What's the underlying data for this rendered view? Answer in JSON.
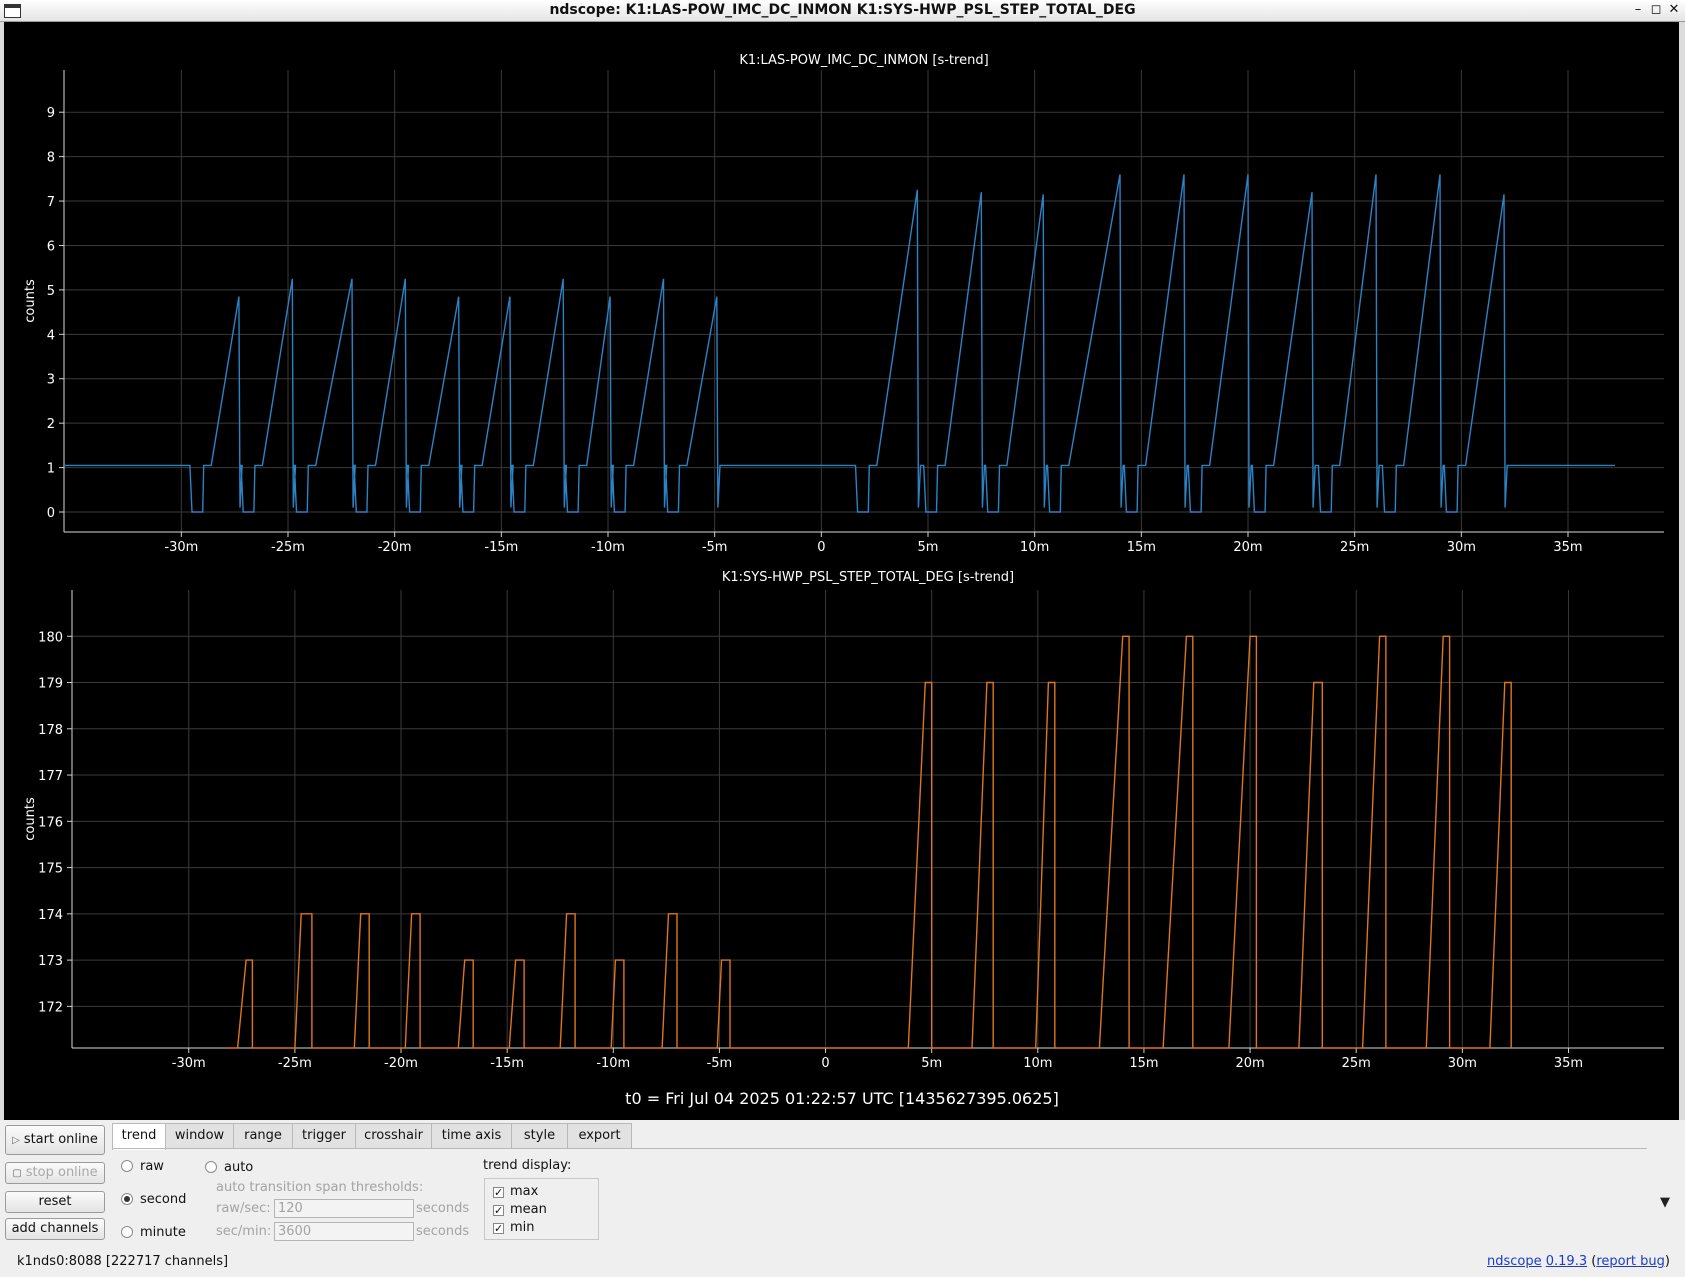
{
  "window": {
    "title": "ndscope: K1:LAS-POW_IMC_DC_INMON K1:SYS-HWP_PSL_STEP_TOTAL_DEG",
    "minimize_glyph": "–",
    "maximize_glyph": "◻",
    "close_glyph": "✕"
  },
  "plots": [
    {
      "title": "K1:LAS-POW_IMC_DC_INMON [s-trend]",
      "ylabel": "counts",
      "yticks": [
        "0",
        "1",
        "2",
        "3",
        "4",
        "5",
        "6",
        "7",
        "8",
        "9"
      ],
      "xticks": [
        "-30m",
        "-25m",
        "-20m",
        "-15m",
        "-10m",
        "-5m",
        "0",
        "5m",
        "10m",
        "15m",
        "20m",
        "25m",
        "30m",
        "35m"
      ]
    },
    {
      "title": "K1:SYS-HWP_PSL_STEP_TOTAL_DEG [s-trend]",
      "ylabel": "counts",
      "yticks": [
        "172",
        "173",
        "174",
        "175",
        "176",
        "177",
        "178",
        "179",
        "180"
      ],
      "xticks": [
        "-30m",
        "-25m",
        "-20m",
        "-15m",
        "-10m",
        "-5m",
        "0",
        "5m",
        "10m",
        "15m",
        "20m",
        "25m",
        "30m",
        "35m"
      ]
    }
  ],
  "t0_label": "t0 = Fri Jul 04 2025 01:22:57 UTC [1435627395.0625]",
  "buttons": {
    "start_online": "start online",
    "stop_online": "stop online",
    "reset": "reset",
    "add_channels": "add channels"
  },
  "tabs": [
    "trend",
    "window",
    "range",
    "trigger",
    "crosshair",
    "time axis",
    "style",
    "export"
  ],
  "trend_tab": {
    "radio_raw": "raw",
    "radio_second": "second",
    "radio_minute": "minute",
    "radio_auto": "auto",
    "thresholds_label": "auto transition span thresholds:",
    "raw_sec_label": "raw/sec:",
    "raw_sec_value": "120",
    "sec_min_label": "sec/min:",
    "sec_min_value": "3600",
    "unit": "seconds",
    "trend_display_label": "trend display:",
    "check_max": "max",
    "check_mean": "mean",
    "check_min": "min",
    "check_glyph": "✓"
  },
  "status": {
    "server": "k1nds0:8088  [222717 channels]",
    "app_link": "ndscope",
    "version_link": "0.19.3",
    "report_link": "report bug",
    "paren_open": "(",
    "paren_close": ")"
  },
  "chart_data": [
    {
      "type": "line",
      "title": "K1:LAS-POW_IMC_DC_INMON [s-trend]",
      "xlabel": "",
      "ylabel": "counts",
      "x_unit": "minutes relative to t0",
      "xlim": [
        -35.5,
        39.5
      ],
      "ylim": [
        -0.45,
        9.95
      ],
      "grid": true,
      "color": "#2b83c6",
      "baseline": 1.05,
      "sawtooth_cycles": [
        {
          "start": -29.5,
          "peak_time": -27.3,
          "peak": 4.85
        },
        {
          "start": -27.1,
          "peak_time": -24.8,
          "peak": 5.25
        },
        {
          "start": -24.6,
          "peak_time": -22.0,
          "peak": 5.25
        },
        {
          "start": -21.8,
          "peak_time": -19.5,
          "peak": 5.25
        },
        {
          "start": -19.3,
          "peak_time": -17.0,
          "peak": 4.85
        },
        {
          "start": -16.8,
          "peak_time": -14.6,
          "peak": 4.85
        },
        {
          "start": -14.4,
          "peak_time": -12.1,
          "peak": 5.25
        },
        {
          "start": -11.9,
          "peak_time": -9.9,
          "peak": 4.85
        },
        {
          "start": -9.7,
          "peak_time": -7.4,
          "peak": 5.25
        },
        {
          "start": -7.2,
          "peak_time": -4.9,
          "peak": 4.85
        },
        {
          "start": 1.7,
          "peak_time": 4.5,
          "peak": 7.25
        },
        {
          "start": 4.9,
          "peak_time": 7.5,
          "peak": 7.2
        },
        {
          "start": 7.8,
          "peak_time": 10.4,
          "peak": 7.15
        },
        {
          "start": 10.7,
          "peak_time": 14.0,
          "peak": 7.6
        },
        {
          "start": 14.3,
          "peak_time": 17.0,
          "peak": 7.6
        },
        {
          "start": 17.3,
          "peak_time": 20.0,
          "peak": 7.6
        },
        {
          "start": 20.3,
          "peak_time": 23.0,
          "peak": 7.2
        },
        {
          "start": 23.4,
          "peak_time": 26.0,
          "peak": 7.6
        },
        {
          "start": 26.4,
          "peak_time": 29.0,
          "peak": 7.6
        },
        {
          "start": 29.3,
          "peak_time": 32.0,
          "peak": 7.15
        }
      ],
      "trace_end": 37.2
    },
    {
      "type": "line",
      "title": "K1:SYS-HWP_PSL_STEP_TOTAL_DEG [s-trend]",
      "xlabel": "",
      "ylabel": "counts",
      "x_unit": "minutes relative to t0",
      "xlim": [
        -35.5,
        39.5
      ],
      "ylim": [
        171.1,
        181.0
      ],
      "grid": true,
      "color": "#e0761b",
      "pulses": [
        {
          "rise_start": -27.7,
          "top_start": -27.3,
          "top_end": -27.0,
          "fall": -27.0,
          "top": 173
        },
        {
          "rise_start": -25.0,
          "top_start": -24.7,
          "top_end": -24.2,
          "fall": -24.2,
          "top": 174
        },
        {
          "rise_start": -22.2,
          "top_start": -21.9,
          "top_end": -21.5,
          "fall": -21.5,
          "top": 174
        },
        {
          "rise_start": -19.8,
          "top_start": -19.5,
          "top_end": -19.1,
          "fall": -19.1,
          "top": 174
        },
        {
          "rise_start": -17.3,
          "top_start": -17.0,
          "top_end": -16.6,
          "fall": -16.6,
          "top": 173
        },
        {
          "rise_start": -14.9,
          "top_start": -14.6,
          "top_end": -14.2,
          "fall": -14.2,
          "top": 173
        },
        {
          "rise_start": -12.5,
          "top_start": -12.2,
          "top_end": -11.8,
          "fall": -11.8,
          "top": 174
        },
        {
          "rise_start": -10.1,
          "top_start": -9.9,
          "top_end": -9.5,
          "fall": -9.5,
          "top": 173
        },
        {
          "rise_start": -7.7,
          "top_start": -7.4,
          "top_end": -7.0,
          "fall": -7.0,
          "top": 174
        },
        {
          "rise_start": -5.1,
          "top_start": -4.9,
          "top_end": -4.5,
          "fall": -4.5,
          "top": 173
        },
        {
          "rise_start": 3.9,
          "top_start": 4.7,
          "top_end": 5.0,
          "fall": 5.0,
          "top": 179
        },
        {
          "rise_start": 6.9,
          "top_start": 7.6,
          "top_end": 7.9,
          "fall": 7.9,
          "top": 179
        },
        {
          "rise_start": 9.9,
          "top_start": 10.5,
          "top_end": 10.8,
          "fall": 10.8,
          "top": 179
        },
        {
          "rise_start": 12.9,
          "top_start": 14.0,
          "top_end": 14.3,
          "fall": 14.3,
          "top": 180
        },
        {
          "rise_start": 15.9,
          "top_start": 17.0,
          "top_end": 17.3,
          "fall": 17.3,
          "top": 180
        },
        {
          "rise_start": 19.0,
          "top_start": 20.0,
          "top_end": 20.3,
          "fall": 20.3,
          "top": 180
        },
        {
          "rise_start": 22.3,
          "top_start": 23.0,
          "top_end": 23.4,
          "fall": 23.4,
          "top": 179
        },
        {
          "rise_start": 25.3,
          "top_start": 26.1,
          "top_end": 26.4,
          "fall": 26.4,
          "top": 180
        },
        {
          "rise_start": 28.3,
          "top_start": 29.1,
          "top_end": 29.4,
          "fall": 29.4,
          "top": 180
        },
        {
          "rise_start": 31.3,
          "top_start": 32.0,
          "top_end": 32.3,
          "fall": 32.3,
          "top": 179
        }
      ]
    }
  ]
}
